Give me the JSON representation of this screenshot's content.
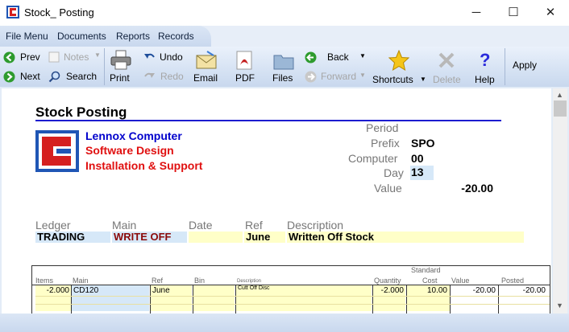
{
  "window": {
    "title": "Stock_ Posting",
    "minimize": "─",
    "maximize": "☐",
    "close": "✕"
  },
  "menu": [
    "File Menu",
    "Documents",
    "Reports",
    "Records"
  ],
  "toolbar": {
    "prev": "Prev",
    "next": "Next",
    "notes": "Notes",
    "search": "Search",
    "print": "Print",
    "undo": "Undo",
    "redo": "Redo",
    "email": "Email",
    "pdf": "PDF",
    "files": "Files",
    "back": "Back",
    "forward": "Forward",
    "shortcuts": "Shortcuts",
    "delete": "Delete",
    "help": "Help",
    "apply": "Apply"
  },
  "doc": {
    "heading": "Stock Posting",
    "company": [
      "Lennox Computer",
      "Software Design",
      "Installation & Support"
    ],
    "period_label": "Period",
    "prefix_label": "Prefix",
    "prefix": "SPO",
    "computer_label": "Computer",
    "computer": "00",
    "day_label": "Day",
    "day": "13",
    "value_label": "Value",
    "value": "-20.00",
    "header_labels": {
      "ledger": "Ledger",
      "main": "Main",
      "date": "Date",
      "ref": "Ref",
      "description": "Description"
    },
    "header_values": {
      "ledger": "TRADING",
      "main": "WRITE OFF",
      "date": "",
      "ref": "June",
      "description": "Written Off Stock"
    }
  },
  "grid": {
    "columns": {
      "items": "Items",
      "main": "Main",
      "ref": "Ref",
      "bin": "Bin",
      "description": "Description",
      "quantity": "Quantity",
      "standard": "Standard",
      "cost": "Cost",
      "value": "Value",
      "posted": "Posted"
    },
    "rows": [
      {
        "items": "-2.000",
        "main": "CD120",
        "ref": "June",
        "bin": "",
        "description": "Cutt Off Disc",
        "quantity": "-2.000",
        "cost": "10.00",
        "value": "-20.00",
        "posted": "-20.00"
      }
    ]
  },
  "colors": {
    "title_blue": "#0000cc",
    "company_red": "#e01010",
    "rule_blue": "#1c1cd0"
  }
}
